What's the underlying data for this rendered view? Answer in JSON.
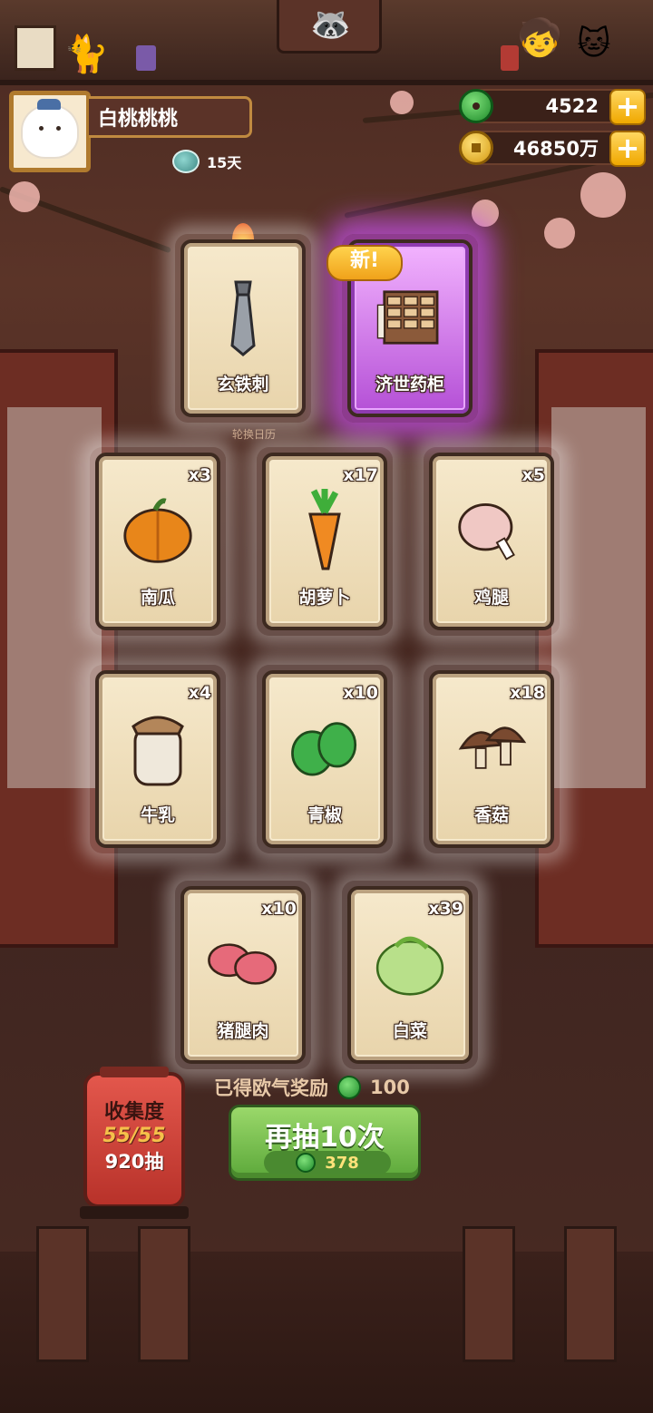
{
  "player": {
    "name": "白桃桃桃",
    "days": "15天"
  },
  "currencies": {
    "jade": "4522",
    "coins": "46850万"
  },
  "featured_cards": [
    {
      "label": "玄铁刺",
      "qty": "",
      "icon": "dagger-icon",
      "highlight": "fire"
    },
    {
      "label": "济世药柜",
      "qty": "",
      "icon": "medicine-cabinet-icon",
      "highlight": "new"
    }
  ],
  "new_badge": "新!",
  "calendar_label": "轮换日历",
  "ingredient_cards": [
    {
      "label": "南瓜",
      "qty": "x3",
      "icon": "pumpkin-icon",
      "color": "#e8861a"
    },
    {
      "label": "胡萝卜",
      "qty": "x17",
      "icon": "carrot-icon",
      "color": "#f08a22"
    },
    {
      "label": "鸡腿",
      "qty": "x5",
      "icon": "chicken-leg-icon",
      "color": "#f0c8c4"
    },
    {
      "label": "牛乳",
      "qty": "x4",
      "icon": "milk-jar-icon",
      "color": "#efe8db"
    },
    {
      "label": "青椒",
      "qty": "x10",
      "icon": "green-pepper-icon",
      "color": "#3fb04a"
    },
    {
      "label": "香菇",
      "qty": "x18",
      "icon": "mushroom-icon",
      "color": "#7a4a30"
    },
    {
      "label": "猪腿肉",
      "qty": "x10",
      "icon": "pork-icon",
      "color": "#e66a7a"
    },
    {
      "label": "白菜",
      "qty": "x39",
      "icon": "cabbage-icon",
      "color": "#b8e08a"
    }
  ],
  "rewards": {
    "text": "已得欧气奖励",
    "amount": "100"
  },
  "redraw_button": {
    "label": "再抽10次",
    "cost": "378"
  },
  "collection": {
    "title": "收集度",
    "progress": "55/55",
    "draws": "920抽"
  }
}
